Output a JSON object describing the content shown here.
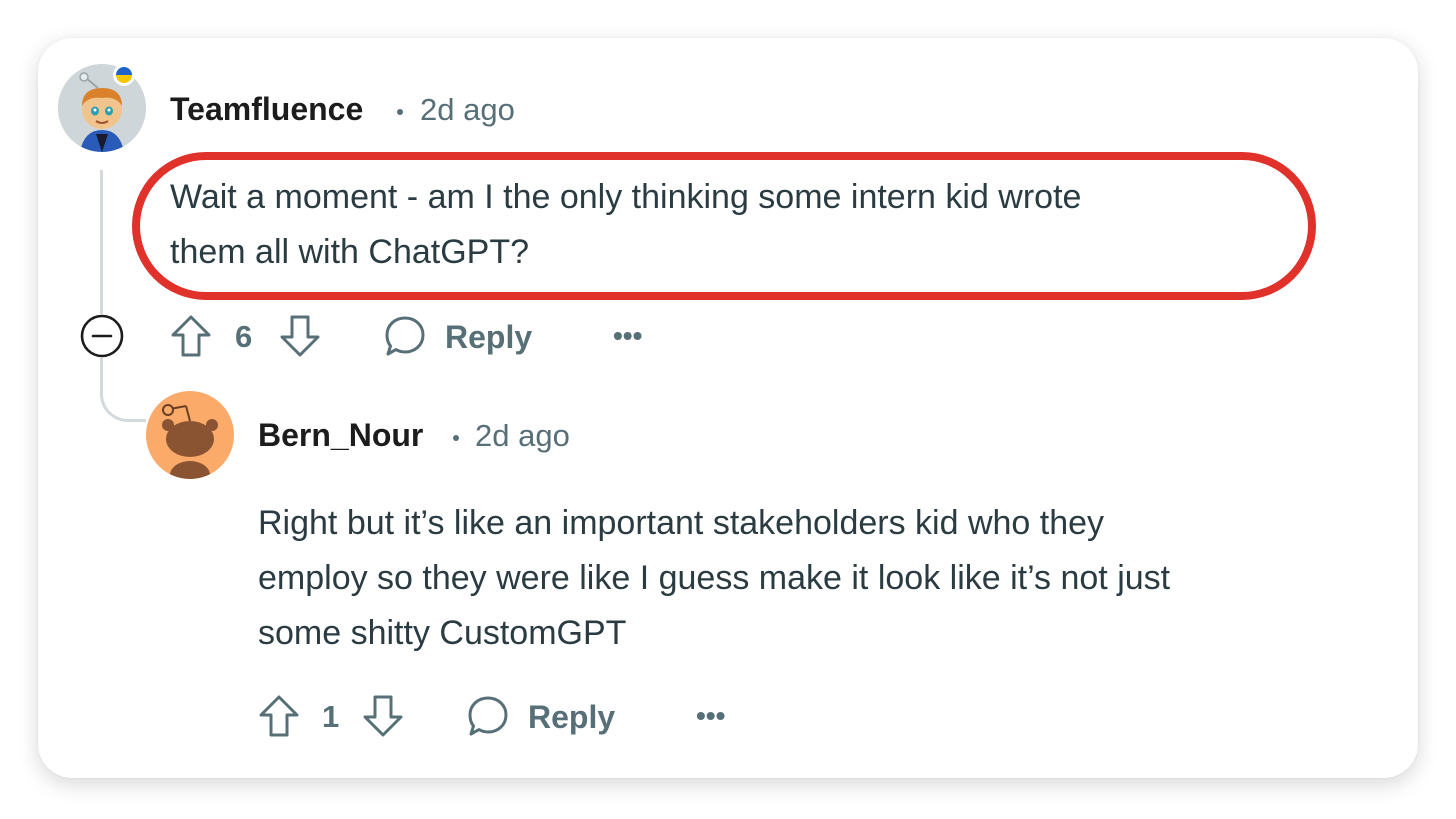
{
  "comment": {
    "username": "Teamfluence",
    "time": "2d ago",
    "body_lines": [
      "Wait a moment - am I the only thinking some intern kid wrote",
      "them all with ChatGPT?"
    ],
    "votes": "6",
    "reply_label": "Reply",
    "more_label": "•••",
    "flag_colors": [
      "#1e63c9",
      "#f7c600"
    ]
  },
  "reply": {
    "username": "Bern_Nour",
    "time": "2d ago",
    "body_lines": [
      "Right but it’s like an important stakeholders kid who they",
      "employ so they were like I guess make it look like it’s not just",
      "some shitty CustomGPT"
    ],
    "votes": "1",
    "reply_label": "Reply",
    "more_label": "•••",
    "avatar_color": "#fcaa6a"
  },
  "colors": {
    "highlight": "#e0322a",
    "meta": "#576f76",
    "text": "#2a3c42",
    "username": "#1c1c1c"
  }
}
